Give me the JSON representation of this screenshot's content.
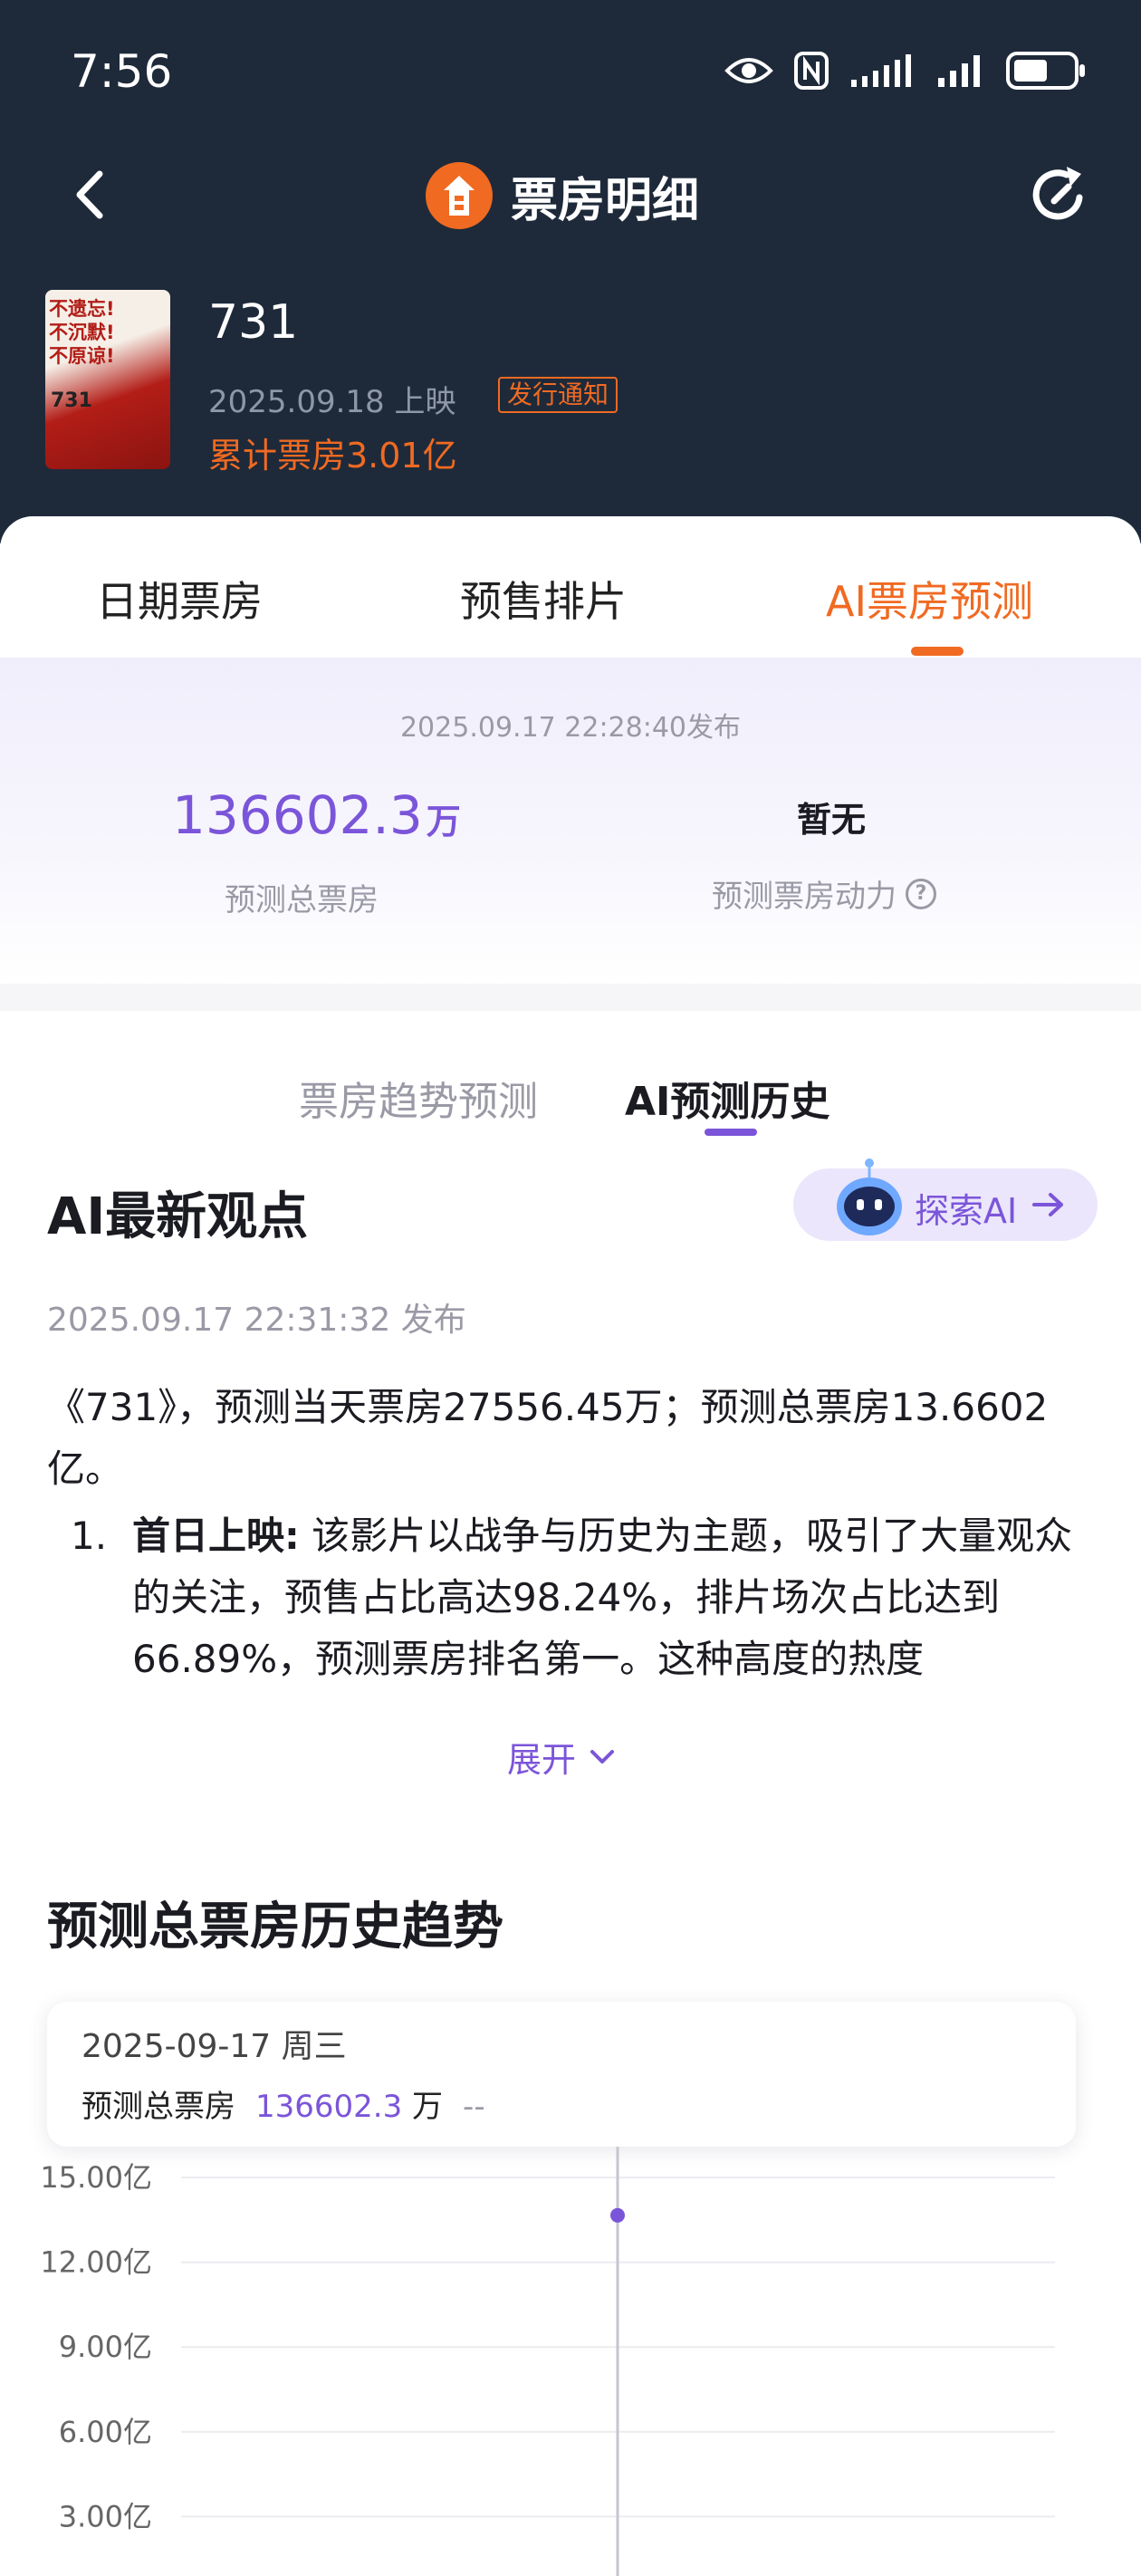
{
  "status_bar": {
    "time": "7:56",
    "icons": [
      "eye-icon",
      "nfc-icon",
      "signal-icon",
      "signal-icon",
      "battery-icon"
    ]
  },
  "nav": {
    "title": "票房明细",
    "back_icon": "chevron-left-icon",
    "refresh_icon": "refresh-icon"
  },
  "movie": {
    "name": "731",
    "release": "2025.09.18 上映",
    "release_tag": "发行通知",
    "total_box_office": "累计票房3.01亿",
    "poster_text": "不遗忘!\n不沉默!\n不原谅!",
    "poster_num": "731"
  },
  "tabs": [
    "日期票房",
    "预售排片",
    "AI票房预测"
  ],
  "active_tab": "AI票房预测",
  "forecast": {
    "published": "2025.09.17 22:28:40发布",
    "total_value": "136602.3",
    "total_unit": "万",
    "total_label": "预测总票房",
    "power_value": "暂无",
    "power_label": "预测票房动力"
  },
  "subtabs": [
    "票房趋势预测",
    "AI预测历史"
  ],
  "active_subtab": "AI预测历史",
  "ai_view": {
    "heading": "AI最新观点",
    "explore_label": "探索AI",
    "published": "2025.09.17 22:31:32 发布",
    "paragraph": "《731》，预测当天票房27556.45万；预测总票房13.6602亿。",
    "item_number": "1.",
    "item_title": "首日上映:",
    "item_text": " 该影片以战争与历史为主题，吸引了大量观众的关注，预售占比高达98.24%，排片场次占比达到66.89%，预测票房排名第一。这种高度的热度",
    "expand_label": "展开"
  },
  "trend": {
    "title": "预测总票房历史趋势",
    "tooltip_date": "2025-09-17  周三",
    "tooltip_label": "预测总票房",
    "tooltip_value": "136602.3",
    "tooltip_unit": "万",
    "tooltip_change": "--"
  },
  "chart_data": {
    "type": "line",
    "y_tick_labels": [
      "15.00亿",
      "12.00亿",
      "9.00亿",
      "6.00亿",
      "3.00亿"
    ],
    "y_ticks": [
      15,
      12,
      9,
      6,
      3
    ],
    "ylim": [
      0,
      15
    ],
    "y_unit": "亿",
    "x": [
      "2025-09-17"
    ],
    "series": [
      {
        "values": [
          13.66023
        ]
      }
    ],
    "grid": true
  },
  "colors": {
    "header_bg": "#1e2a3a",
    "accent_orange": "#f06a22",
    "accent_purple": "#7b55d9"
  }
}
